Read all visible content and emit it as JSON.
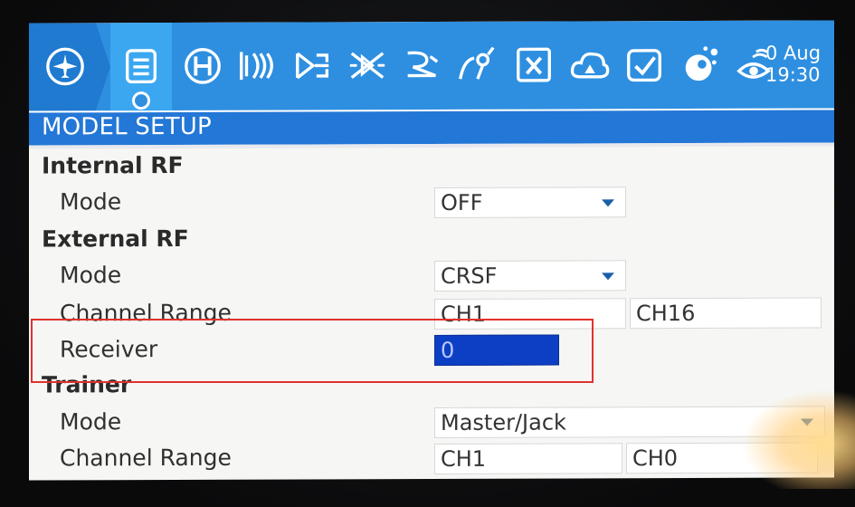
{
  "header": {
    "clock_date": "0 Aug",
    "clock_time": "19:30",
    "tabs": [
      {
        "icon": "airplane-icon"
      },
      {
        "icon": "model-setup-icon",
        "active": true
      },
      {
        "icon": "heli-icon"
      },
      {
        "icon": "flight-modes-icon"
      },
      {
        "icon": "inputs-icon"
      },
      {
        "icon": "mixer-icon"
      },
      {
        "icon": "outputs-icon"
      },
      {
        "icon": "curves-icon"
      },
      {
        "icon": "global-variables-icon"
      },
      {
        "icon": "logical-switches-icon"
      },
      {
        "icon": "special-functions-icon"
      },
      {
        "icon": "lua-scripts-icon"
      },
      {
        "icon": "telemetry-icon"
      }
    ]
  },
  "page": {
    "title": "MODEL SETUP"
  },
  "internal_rf": {
    "section": "Internal RF",
    "mode_label": "Mode",
    "mode_value": "OFF"
  },
  "external_rf": {
    "section": "External RF",
    "mode_label": "Mode",
    "mode_value": "CRSF",
    "channel_range_label": "Channel Range",
    "channel_start": "CH1",
    "channel_end": "CH16",
    "receiver_label": "Receiver",
    "receiver_value": "0"
  },
  "trainer": {
    "section": "Trainer",
    "mode_label": "Mode",
    "mode_value": "Master/Jack",
    "channel_range_label": "Channel Range",
    "channel_start": "CH1",
    "channel_end": "CH0"
  },
  "colors": {
    "toolbar": "#2e8fe0",
    "titlebar": "#2377d6",
    "editing_field": "#0d3fc4",
    "annotation": "#e0322c"
  }
}
